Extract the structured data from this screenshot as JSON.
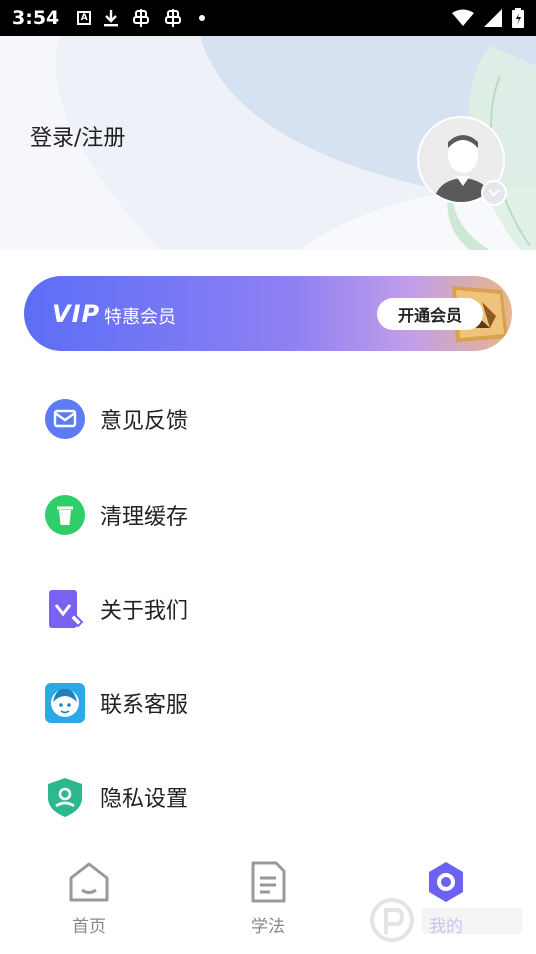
{
  "status_bar": {
    "time": "3:54"
  },
  "header": {
    "login_text": "登录/注册"
  },
  "vip": {
    "logo": "VIP",
    "subtitle": "特惠会员",
    "button_label": "开通会员"
  },
  "menu": {
    "items": [
      {
        "label": "意见反馈",
        "icon": "mail-icon",
        "color": "#5b7cf5"
      },
      {
        "label": "清理缓存",
        "icon": "trash-icon",
        "color": "#2ecf6a"
      },
      {
        "label": "关于我们",
        "icon": "document-check-icon",
        "color": "#7b61f1"
      },
      {
        "label": "联系客服",
        "icon": "customer-service-icon",
        "color": "#2ba9e6"
      },
      {
        "label": "隐私设置",
        "icon": "privacy-shield-icon",
        "color": "#2cb78e"
      }
    ]
  },
  "bottom_nav": {
    "items": [
      {
        "label": "首页",
        "icon": "home-icon"
      },
      {
        "label": "学法",
        "icon": "document-icon"
      },
      {
        "label": "我的",
        "icon": "settings-icon",
        "active": true
      }
    ]
  },
  "colors": {
    "accent": "#6a63f0",
    "header_bg": "#eef1f7"
  }
}
